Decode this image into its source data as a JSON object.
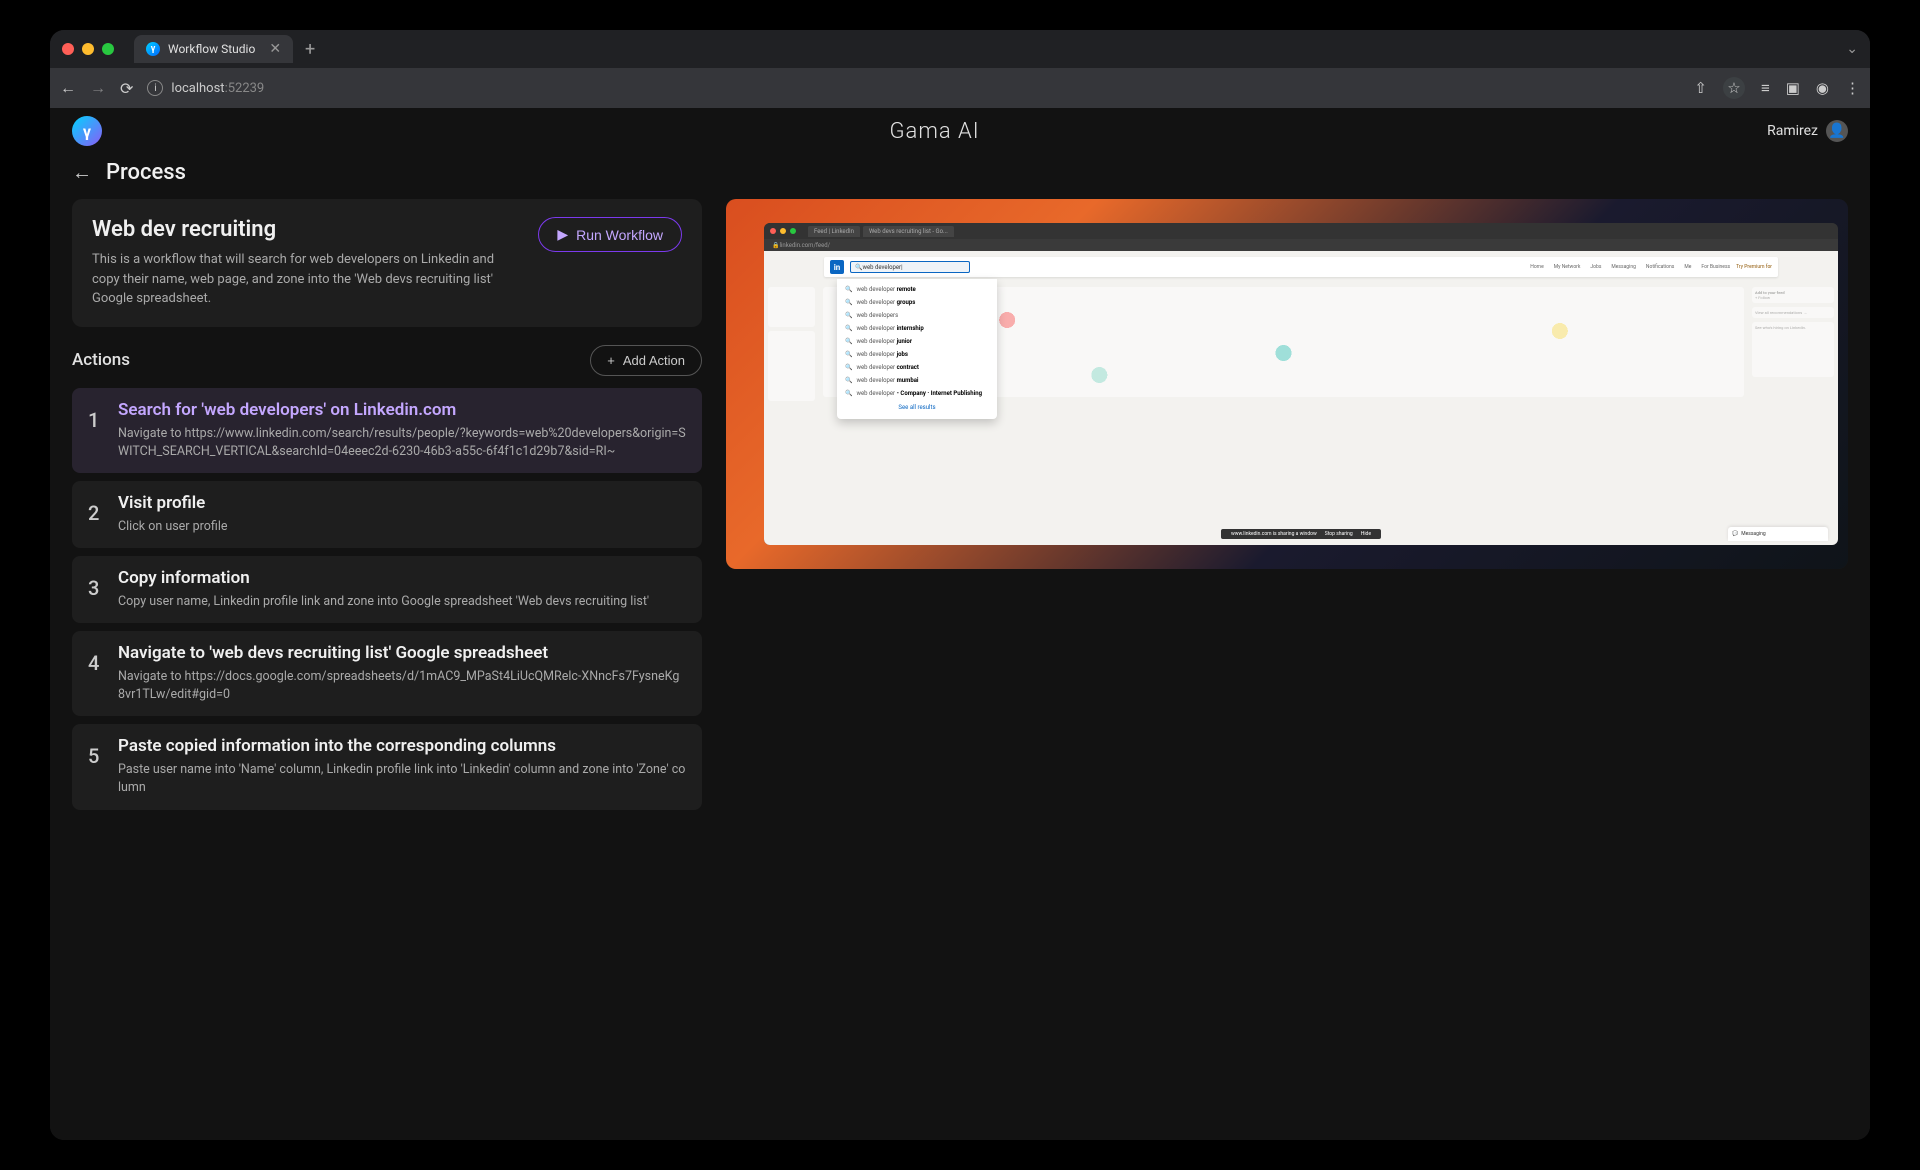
{
  "browser": {
    "tab_title": "Workflow Studio",
    "url_host": "localhost",
    "url_port": ":52239"
  },
  "app": {
    "title": "Gama AI",
    "user_name": "Ramirez",
    "logo_letter": "γ"
  },
  "breadcrumb": {
    "title": "Process"
  },
  "workflow": {
    "title": "Web dev recruiting",
    "description": "This is a workflow that will search for web developers on Linkedin and copy their name, web page, and zone into the 'Web devs recruiting list' Google spreadsheet.",
    "run_label": "Run Workflow"
  },
  "actions_header": {
    "title": "Actions",
    "add_label": "Add Action"
  },
  "actions": [
    {
      "num": "1",
      "title": "Search for 'web developers' on Linkedin.com",
      "desc": "Navigate to https://www.linkedin.com/search/results/people/?keywords=web%20developers&origin=SWITCH_SEARCH_VERTICAL&searchId=04eeec2d-6230-46b3-a55c-6f4f1c1d29b7&sid=RI~",
      "selected": true
    },
    {
      "num": "2",
      "title": "Visit profile",
      "desc": "Click on user profile",
      "selected": false
    },
    {
      "num": "3",
      "title": "Copy information",
      "desc": "Copy user name, Linkedin profile link and zone into Google spreadsheet 'Web devs recruiting list'",
      "selected": false
    },
    {
      "num": "4",
      "title": "Navigate to 'web devs recruiting list' Google spreadsheet",
      "desc": "Navigate to https://docs.google.com/spreadsheets/d/1mAC9_MPaSt4LiUcQMRelc-XNncFs7FysneKg8vr1TLw/edit#gid=0",
      "selected": false
    },
    {
      "num": "5",
      "title": "Paste copied information into the corresponding columns",
      "desc": "Paste user name into 'Name' column, Linkedin profile link into 'Linkedin' column and zone into 'Zone' column",
      "selected": false
    }
  ],
  "preview": {
    "tabs": [
      "Feed | LinkedIn",
      "Web devs recruiting list - Go..."
    ],
    "url": "linkedin.com/feed/",
    "search_value": "web developer",
    "nav_items": [
      "Home",
      "My Network",
      "Jobs",
      "Messaging",
      "Notifications",
      "Me",
      "For Business"
    ],
    "premium": "Try Premium for",
    "suggestions": [
      {
        "prefix": "web developer",
        "suffix": "remote"
      },
      {
        "prefix": "web developer",
        "suffix": "groups"
      },
      {
        "prefix": "web developers",
        "suffix": ""
      },
      {
        "prefix": "web developer",
        "suffix": "internship"
      },
      {
        "prefix": "web developer",
        "suffix": "junior"
      },
      {
        "prefix": "web developer",
        "suffix": "jobs"
      },
      {
        "prefix": "web developer",
        "suffix": "contract"
      },
      {
        "prefix": "web developer",
        "suffix": "mumbai"
      },
      {
        "prefix": "web developer",
        "suffix": "- Company · Internet Publishing"
      }
    ],
    "see_all": "See all results",
    "sharing_text": "www.linkedin.com is sharing a window",
    "stop_sharing": "Stop sharing",
    "hide": "Hide",
    "messaging": "Messaging",
    "add_to_feed": "Add to your feed",
    "follow": "+ Follow",
    "view_recs": "View all recommendations →",
    "hiring_ad": "See who's hiring on LinkedIn."
  }
}
